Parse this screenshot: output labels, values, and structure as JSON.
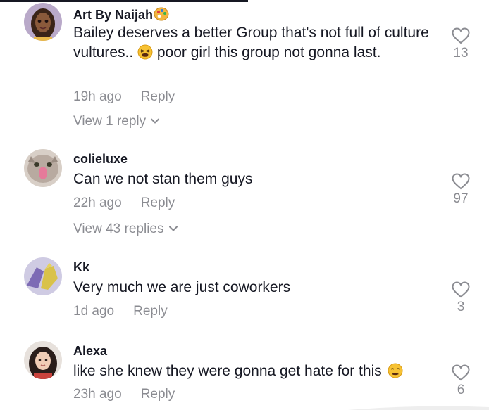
{
  "comments": [
    {
      "username": "Art By Naijah",
      "username_emoji": "artist-palette-icon",
      "text_parts": [
        "Bailey deserves a better Group that's not full of culture vultures.. ",
        " poor girl this group not gonna last."
      ],
      "text_emoji": "tired-face-icon",
      "time": "19h ago",
      "reply_label": "Reply",
      "view_replies": "View 1 reply",
      "likes": "13"
    },
    {
      "username": "colieluxe",
      "text": "Can we not stan them guys",
      "time": "22h ago",
      "reply_label": "Reply",
      "view_replies": "View 43 replies",
      "likes": "97"
    },
    {
      "username": "Kk",
      "text": "Very much we are just coworkers",
      "time": "1d ago",
      "reply_label": "Reply",
      "likes": "3"
    },
    {
      "username": "Alexa",
      "text": "like she knew they were gonna get hate for this",
      "text_emoji": "weary-face-icon",
      "time": "23h ago",
      "reply_label": "Reply",
      "likes": "6"
    }
  ],
  "colors": {
    "primary_text": "#161823",
    "secondary_text": "#8a8b91",
    "emoji_yellow": "#f7b731"
  }
}
